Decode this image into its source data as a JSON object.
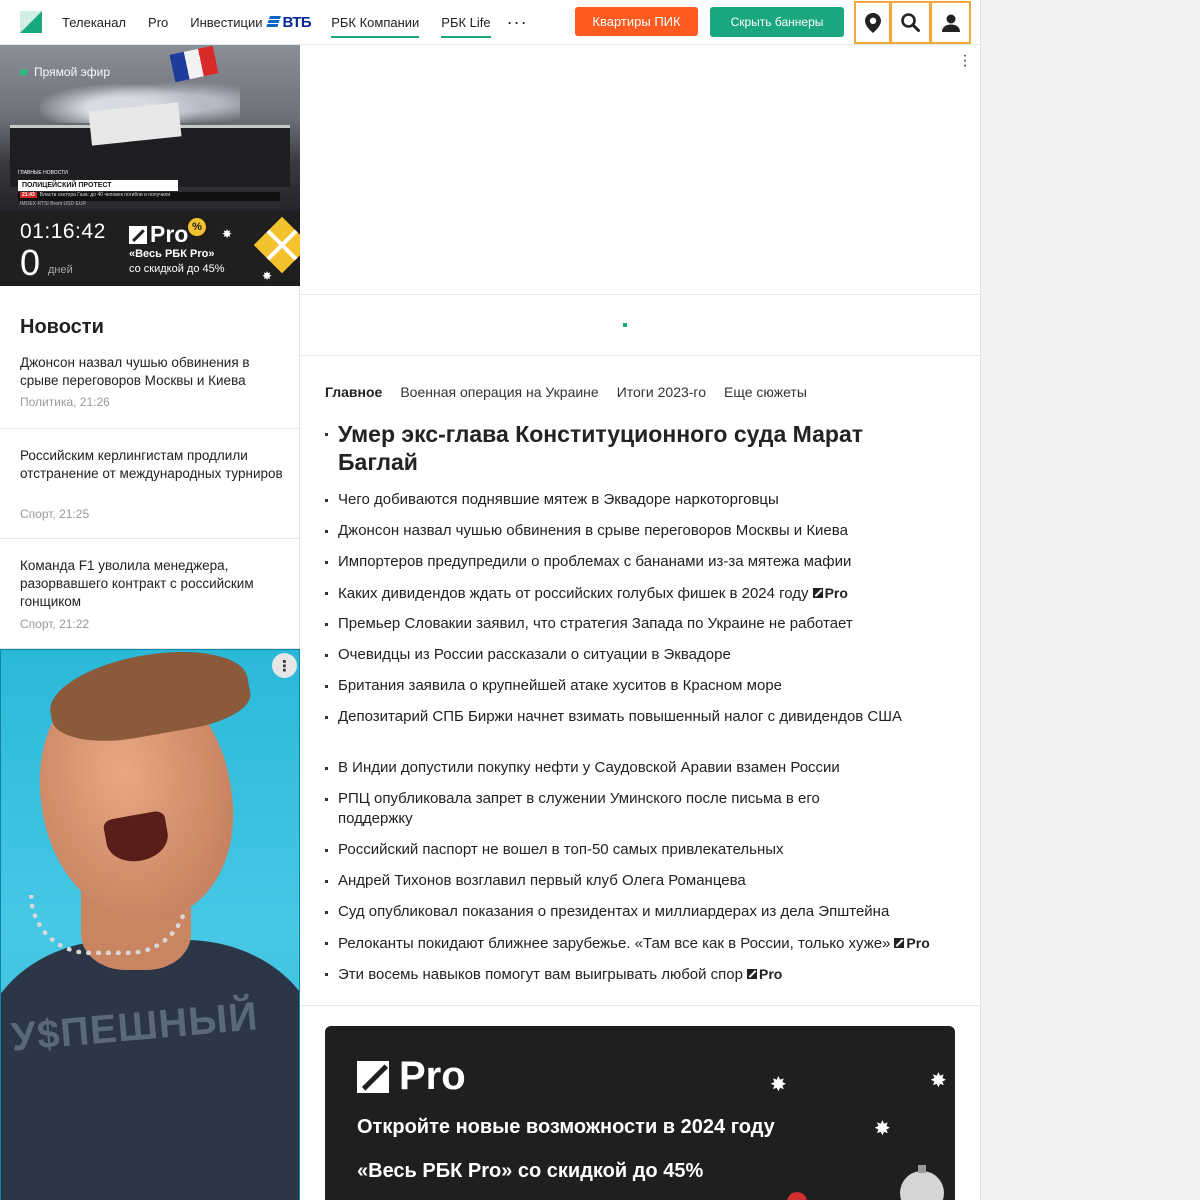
{
  "header": {
    "nav": [
      "Телеканал",
      "Pro",
      "Инвестиции",
      "РБК Компании",
      "РБК Life"
    ],
    "vtb": "ВТБ",
    "more": "···",
    "pik_button": "Квартиры ПИК",
    "hide_button": "Скрыть баннеры"
  },
  "live": {
    "label": "Прямой эфир",
    "kicker": "ГЛАВНЫЕ НОВОСТИ",
    "headline": "ПОЛИЦЕЙСКИЙ ПРОТЕСТ",
    "ticker_time": "21:43",
    "ticker": "Власти сектора Газа: до 40 человек погибли и получили",
    "ticker2": "IMOEX  RTSI  Brent  USD  EUR"
  },
  "promo_small": {
    "timer": "01:16:42",
    "days_num": "0",
    "days_label": "дней",
    "pro": "Pro",
    "badge": "%",
    "line1": "«Весь РБК Pro»",
    "line2": "со скидкой до 45%"
  },
  "news": {
    "title": "Новости",
    "items": [
      {
        "text": "Джонсон назвал чушью обвинения в срыве переговоров Москвы и Киева",
        "meta": "Политика, 21:26"
      },
      {
        "text": "Российским керлингистам продлили отстранение от международных турниров",
        "meta": "Спорт, 21:25"
      },
      {
        "text": "Команда F1 уволила менеджера, разорвавшего контракт с российским гонщиком",
        "meta": "Спорт, 21:22"
      }
    ]
  },
  "ad_left": {
    "word": "У$ПЕШНЫЙ",
    "menu": "⋮"
  },
  "tabs": [
    "Главное",
    "Военная операция на Украине",
    "Итоги 2023-го",
    "Еще сюжеты"
  ],
  "headlines": {
    "main": "Умер экс-глава Конституционного суда Марат Баглай",
    "items": [
      {
        "text": "Чего добиваются поднявшие мятеж в Эквадоре наркоторговцы",
        "pro": ""
      },
      {
        "text": "Джонсон назвал чушью обвинения в срыве переговоров Москвы и Киева",
        "pro": ""
      },
      {
        "text": "Импортеров предупредили о проблемах с бананами из-за мятежа мафии",
        "pro": ""
      },
      {
        "text": "Каких дивидендов ждать от российских голубых фишек в 2024 году",
        "pro": "Pro"
      },
      {
        "text": "Премьер Словакии заявил, что стратегия Запада по Украине не работает",
        "pro": ""
      },
      {
        "text": "Очевидцы из России рассказали о ситуации в Эквадоре",
        "pro": ""
      },
      {
        "text": "Британия заявила о крупнейшей атаке хуситов в Красном море",
        "pro": ""
      },
      {
        "text": "Депозитарий СПБ Биржи начнет взимать повышенный налог с дивидендов США",
        "pro": ""
      },
      {
        "text": "В Индии допустили покупку нефти у Саудовской Аравии взамен России",
        "pro": ""
      },
      {
        "text": "РПЦ опубликовала запрет в служении Уминского после письма в его поддержку",
        "pro": ""
      },
      {
        "text": "Российский паспорт не вошел в топ-50 самых привлекательных",
        "pro": ""
      },
      {
        "text": "Андрей Тихонов возглавил первый клуб Олега Романцева",
        "pro": ""
      },
      {
        "text": "Суд опубликовал показания о президентах и миллиардерах из дела Эпштейна",
        "pro": ""
      },
      {
        "text": "Релоканты покидают ближнее зарубежье. «Там все как в России, только хуже»",
        "pro": "Pro"
      },
      {
        "text": "Эти восемь навыков помогут вам выигрывать любой спор",
        "pro": "Pro"
      }
    ]
  },
  "promo_big": {
    "pro": "Pro",
    "headline": "Откройте новые возможности в 2024 году",
    "sub": "«Весь РБК Pro» со скидкой до 45%"
  }
}
